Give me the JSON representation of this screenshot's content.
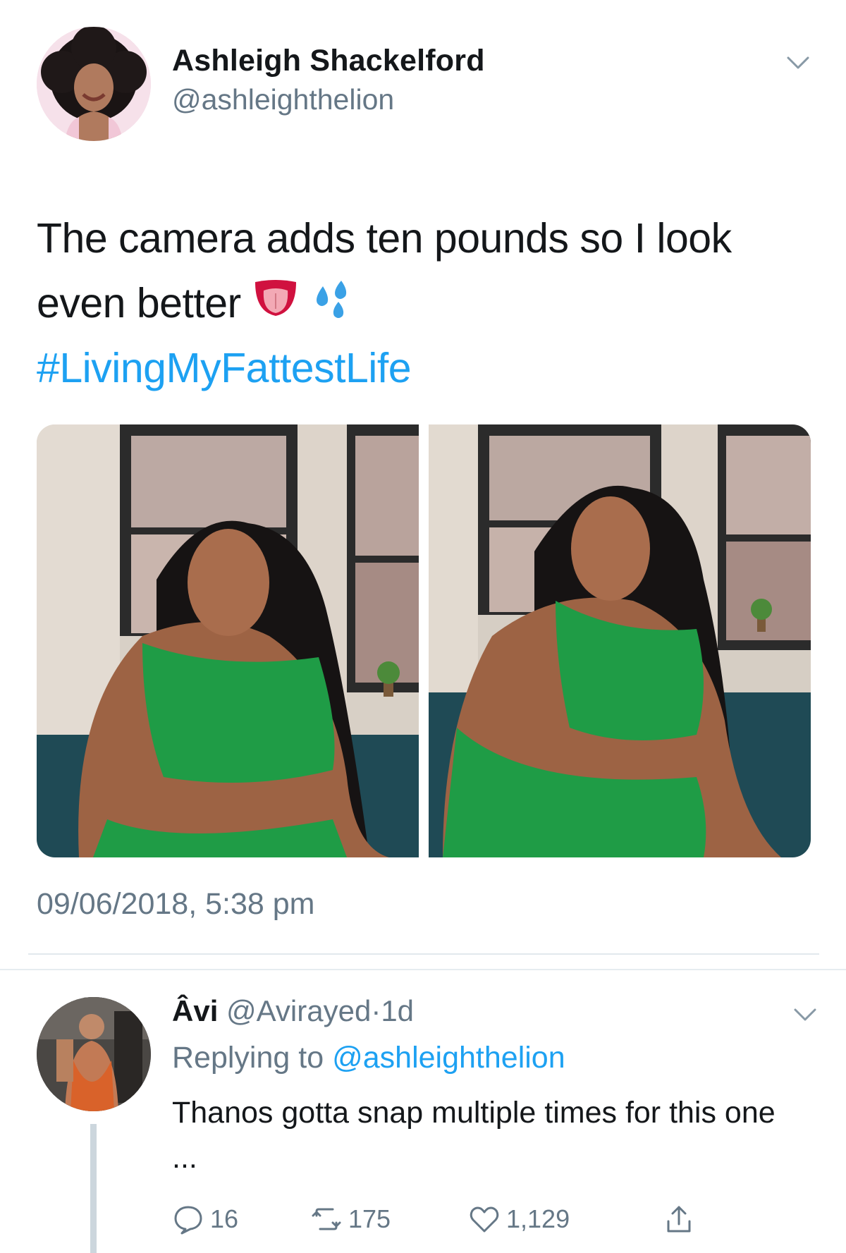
{
  "tweet": {
    "author_name": "Ashleigh Shackelford",
    "author_handle": "@ashleighthelion",
    "text_line1": "The camera adds ten pounds so I look",
    "text_line2": "even better",
    "emojis": [
      "tongue-emoji",
      "sweat-droplets-emoji"
    ],
    "hashtag": "#LivingMyFattestLife",
    "timestamp": "09/06/2018, 5:38 pm",
    "photos": [
      "photo-woman-green-swimsuit-1",
      "photo-woman-green-swimsuit-2"
    ]
  },
  "reply": {
    "name": "Âvi",
    "handle": "@Avirayed",
    "dot": "·",
    "time": "1d",
    "replying_prefix": "Replying to",
    "replying_mention": "@ashleighthelion",
    "text": "Thanos gotta snap multiple times for this one ...",
    "actions": {
      "replies": "16",
      "retweets": "175",
      "likes": "1,129"
    }
  },
  "colors": {
    "link": "#1da1f2",
    "secondary_text": "#657786",
    "primary_text": "#14171a",
    "divider": "#e1e8ed",
    "thread_line": "#ccd6dd"
  }
}
